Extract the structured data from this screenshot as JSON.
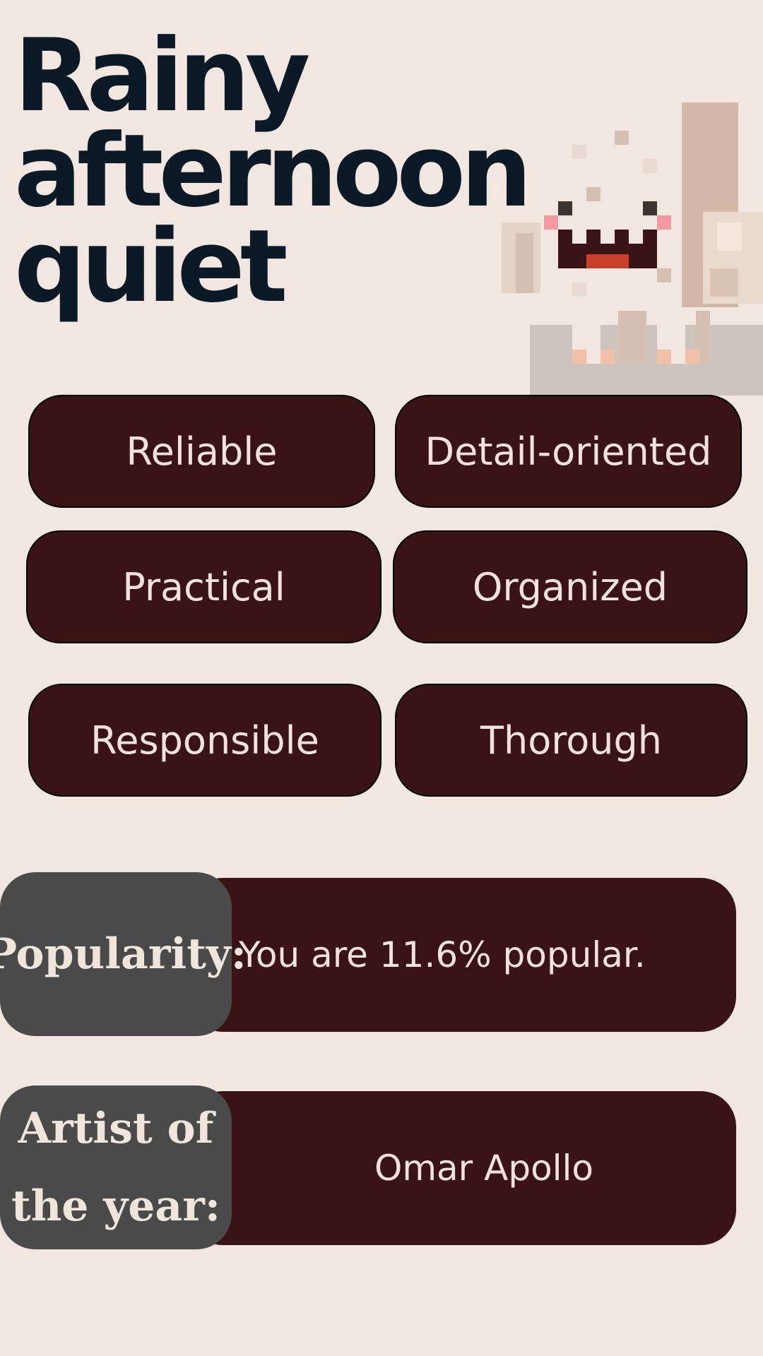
{
  "title": {
    "line1": "Rainy",
    "line2": "afternoon",
    "line3": "quiet"
  },
  "mascot": {
    "icon": "pixel-ghost-mascot-icon"
  },
  "traits": [
    "Reliable",
    "Detail-oriented",
    "Practical",
    "Organized",
    "Responsible",
    "Thorough"
  ],
  "popularity": {
    "label": "Popularity:",
    "value": "You are 11.6% popular."
  },
  "artist": {
    "label_line1": "Artist of",
    "label_line2": "the year:",
    "value": "Omar Apollo"
  },
  "colors": {
    "background": "#f2e7e0",
    "title": "#0c1a27",
    "pill": "#3a1415",
    "label": "#4a4a4a",
    "pill_text": "#f2e3da"
  }
}
